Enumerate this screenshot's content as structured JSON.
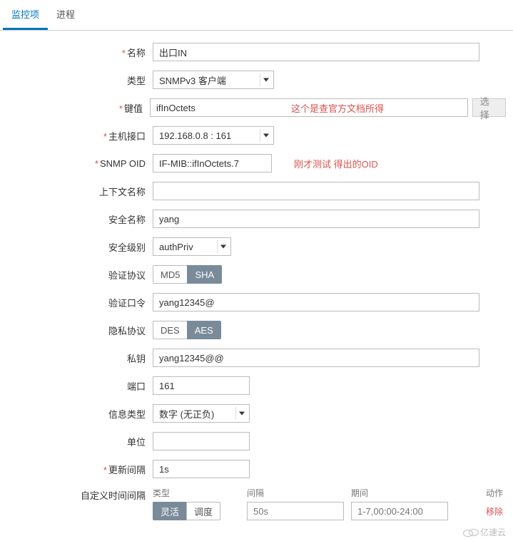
{
  "tabs": [
    {
      "label": "监控项",
      "active": true
    },
    {
      "label": "进程",
      "active": false
    }
  ],
  "form": {
    "name": {
      "label": "名称",
      "value": "出口IN",
      "required": true
    },
    "type": {
      "label": "类型",
      "value": "SNMPv3 客户端"
    },
    "key": {
      "label": "键值",
      "value": "ifInOctets",
      "required": true,
      "hint": "这个是查官方文档所得",
      "btn": "选择"
    },
    "host": {
      "label": "主机接口",
      "value": "192.168.0.8 : 161",
      "required": true
    },
    "oid": {
      "label": "SNMP OID",
      "value": "IF-MIB::ifInOctets.7",
      "required": true,
      "hint": "刚才测试 得出的OID"
    },
    "context": {
      "label": "上下文名称",
      "value": ""
    },
    "secname": {
      "label": "安全名称",
      "value": "yang"
    },
    "seclevel": {
      "label": "安全级别",
      "value": "authPriv"
    },
    "authproto": {
      "label": "验证协议",
      "opts": [
        "MD5",
        "SHA"
      ]
    },
    "authpass": {
      "label": "验证口令",
      "value": "yang12345@"
    },
    "privproto": {
      "label": "隐私协议",
      "opts": [
        "DES",
        "AES"
      ]
    },
    "privkey": {
      "label": "私钥",
      "value": "yang12345@@"
    },
    "port": {
      "label": "端口",
      "value": "161"
    },
    "datatype": {
      "label": "信息类型",
      "value": "数字 (无正负)"
    },
    "unit": {
      "label": "单位",
      "value": ""
    },
    "interval": {
      "label": "更新间隔",
      "value": "1s",
      "required": true
    },
    "custom": {
      "label": "自定义时间间隔",
      "headers": {
        "type": "类型",
        "interval": "间隔",
        "period": "期间",
        "action": "动作"
      },
      "type_opts": [
        "灵活",
        "调度"
      ],
      "interval_ph": "50s",
      "period_ph": "1-7,00:00-24:00",
      "remove": "移除"
    }
  },
  "logo": "亿速云"
}
